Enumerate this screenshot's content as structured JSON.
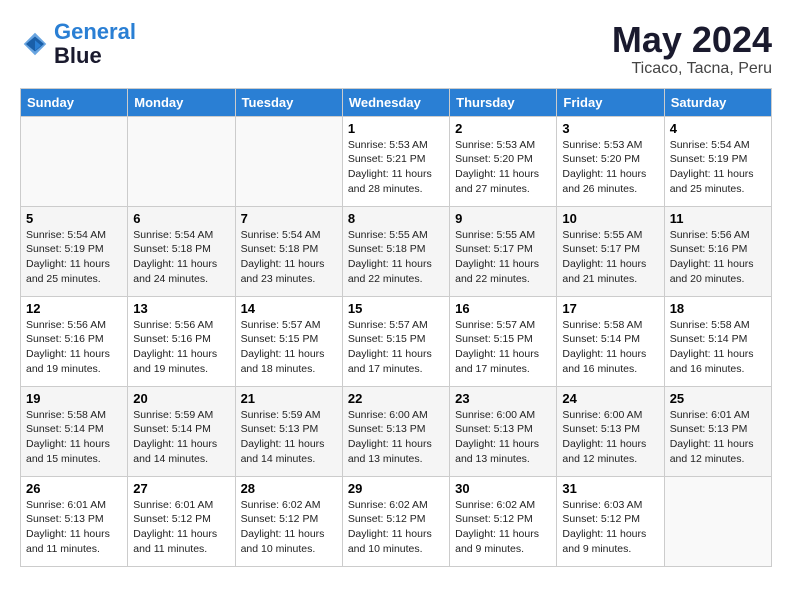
{
  "header": {
    "logo_line1": "General",
    "logo_line2": "Blue",
    "month_year": "May 2024",
    "location": "Ticaco, Tacna, Peru"
  },
  "days_of_week": [
    "Sunday",
    "Monday",
    "Tuesday",
    "Wednesday",
    "Thursday",
    "Friday",
    "Saturday"
  ],
  "weeks": [
    [
      {
        "day": "",
        "info": ""
      },
      {
        "day": "",
        "info": ""
      },
      {
        "day": "",
        "info": ""
      },
      {
        "day": "1",
        "info": "Sunrise: 5:53 AM\nSunset: 5:21 PM\nDaylight: 11 hours\nand 28 minutes."
      },
      {
        "day": "2",
        "info": "Sunrise: 5:53 AM\nSunset: 5:20 PM\nDaylight: 11 hours\nand 27 minutes."
      },
      {
        "day": "3",
        "info": "Sunrise: 5:53 AM\nSunset: 5:20 PM\nDaylight: 11 hours\nand 26 minutes."
      },
      {
        "day": "4",
        "info": "Sunrise: 5:54 AM\nSunset: 5:19 PM\nDaylight: 11 hours\nand 25 minutes."
      }
    ],
    [
      {
        "day": "5",
        "info": "Sunrise: 5:54 AM\nSunset: 5:19 PM\nDaylight: 11 hours\nand 25 minutes."
      },
      {
        "day": "6",
        "info": "Sunrise: 5:54 AM\nSunset: 5:18 PM\nDaylight: 11 hours\nand 24 minutes."
      },
      {
        "day": "7",
        "info": "Sunrise: 5:54 AM\nSunset: 5:18 PM\nDaylight: 11 hours\nand 23 minutes."
      },
      {
        "day": "8",
        "info": "Sunrise: 5:55 AM\nSunset: 5:18 PM\nDaylight: 11 hours\nand 22 minutes."
      },
      {
        "day": "9",
        "info": "Sunrise: 5:55 AM\nSunset: 5:17 PM\nDaylight: 11 hours\nand 22 minutes."
      },
      {
        "day": "10",
        "info": "Sunrise: 5:55 AM\nSunset: 5:17 PM\nDaylight: 11 hours\nand 21 minutes."
      },
      {
        "day": "11",
        "info": "Sunrise: 5:56 AM\nSunset: 5:16 PM\nDaylight: 11 hours\nand 20 minutes."
      }
    ],
    [
      {
        "day": "12",
        "info": "Sunrise: 5:56 AM\nSunset: 5:16 PM\nDaylight: 11 hours\nand 19 minutes."
      },
      {
        "day": "13",
        "info": "Sunrise: 5:56 AM\nSunset: 5:16 PM\nDaylight: 11 hours\nand 19 minutes."
      },
      {
        "day": "14",
        "info": "Sunrise: 5:57 AM\nSunset: 5:15 PM\nDaylight: 11 hours\nand 18 minutes."
      },
      {
        "day": "15",
        "info": "Sunrise: 5:57 AM\nSunset: 5:15 PM\nDaylight: 11 hours\nand 17 minutes."
      },
      {
        "day": "16",
        "info": "Sunrise: 5:57 AM\nSunset: 5:15 PM\nDaylight: 11 hours\nand 17 minutes."
      },
      {
        "day": "17",
        "info": "Sunrise: 5:58 AM\nSunset: 5:14 PM\nDaylight: 11 hours\nand 16 minutes."
      },
      {
        "day": "18",
        "info": "Sunrise: 5:58 AM\nSunset: 5:14 PM\nDaylight: 11 hours\nand 16 minutes."
      }
    ],
    [
      {
        "day": "19",
        "info": "Sunrise: 5:58 AM\nSunset: 5:14 PM\nDaylight: 11 hours\nand 15 minutes."
      },
      {
        "day": "20",
        "info": "Sunrise: 5:59 AM\nSunset: 5:14 PM\nDaylight: 11 hours\nand 14 minutes."
      },
      {
        "day": "21",
        "info": "Sunrise: 5:59 AM\nSunset: 5:13 PM\nDaylight: 11 hours\nand 14 minutes."
      },
      {
        "day": "22",
        "info": "Sunrise: 6:00 AM\nSunset: 5:13 PM\nDaylight: 11 hours\nand 13 minutes."
      },
      {
        "day": "23",
        "info": "Sunrise: 6:00 AM\nSunset: 5:13 PM\nDaylight: 11 hours\nand 13 minutes."
      },
      {
        "day": "24",
        "info": "Sunrise: 6:00 AM\nSunset: 5:13 PM\nDaylight: 11 hours\nand 12 minutes."
      },
      {
        "day": "25",
        "info": "Sunrise: 6:01 AM\nSunset: 5:13 PM\nDaylight: 11 hours\nand 12 minutes."
      }
    ],
    [
      {
        "day": "26",
        "info": "Sunrise: 6:01 AM\nSunset: 5:13 PM\nDaylight: 11 hours\nand 11 minutes."
      },
      {
        "day": "27",
        "info": "Sunrise: 6:01 AM\nSunset: 5:12 PM\nDaylight: 11 hours\nand 11 minutes."
      },
      {
        "day": "28",
        "info": "Sunrise: 6:02 AM\nSunset: 5:12 PM\nDaylight: 11 hours\nand 10 minutes."
      },
      {
        "day": "29",
        "info": "Sunrise: 6:02 AM\nSunset: 5:12 PM\nDaylight: 11 hours\nand 10 minutes."
      },
      {
        "day": "30",
        "info": "Sunrise: 6:02 AM\nSunset: 5:12 PM\nDaylight: 11 hours\nand 9 minutes."
      },
      {
        "day": "31",
        "info": "Sunrise: 6:03 AM\nSunset: 5:12 PM\nDaylight: 11 hours\nand 9 minutes."
      },
      {
        "day": "",
        "info": ""
      }
    ]
  ]
}
